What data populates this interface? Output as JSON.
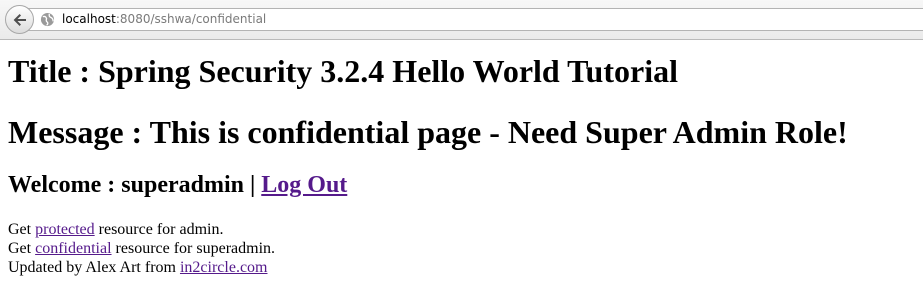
{
  "browser": {
    "url_host": "localhost",
    "url_rest": ":8080/sshwa/confidential"
  },
  "page": {
    "title": "Title : Spring Security 3.2.4 Hello World Tutorial",
    "message": "Message : This is confidential page - Need Super Admin Role!",
    "welcome_prefix": "Welcome : superadmin | ",
    "logout_link": "Log Out",
    "lines": [
      {
        "prefix": "Get ",
        "link": "protected",
        "suffix": " resource for admin."
      },
      {
        "prefix": "Get ",
        "link": "confidential",
        "suffix": " resource for superadmin."
      },
      {
        "prefix": "Updated by Alex Art from ",
        "link": "in2circle.com",
        "suffix": ""
      }
    ]
  }
}
